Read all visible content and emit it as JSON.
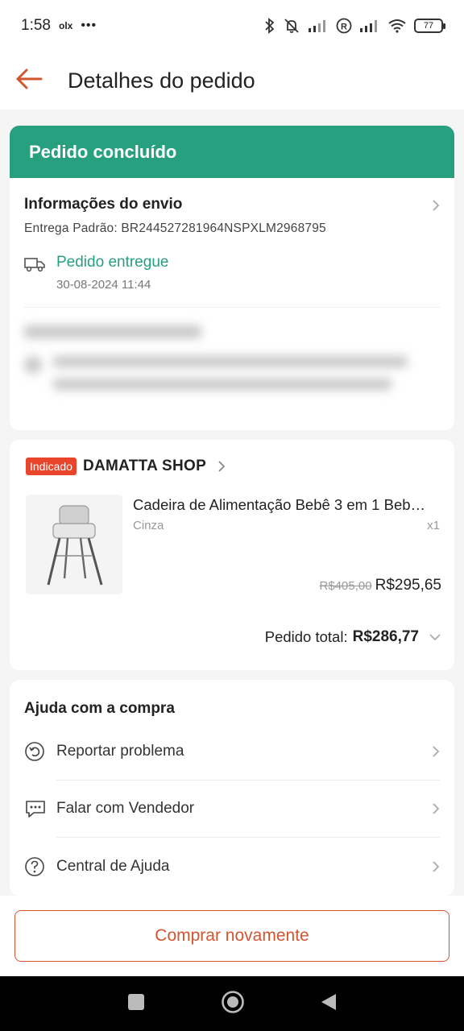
{
  "status_bar": {
    "time": "1:58",
    "olx": "olx",
    "dots": "•••",
    "battery": "77"
  },
  "header": {
    "title": "Detalhes do pedido"
  },
  "order_status": {
    "banner": "Pedido concluído",
    "shipping_title": "Informações do envio",
    "shipping_code": "Entrega Padrão: BR244527281964NSPXLM2968795",
    "delivery_status": "Pedido entregue",
    "delivery_date": "30-08-2024 11:44"
  },
  "shop": {
    "badge": "Indicado",
    "name": "DAMATTA SHOP",
    "product_name": "Cadeira de Alimentação Bebê 3 em 1 Beb…",
    "variant": "Cinza",
    "quantity": "x1",
    "old_price": "R$405,00",
    "price": "R$295,65",
    "total_label": "Pedido total:",
    "total_value": "R$286,77"
  },
  "help": {
    "title": "Ajuda com a compra",
    "items": [
      {
        "label": "Reportar problema"
      },
      {
        "label": "Falar com Vendedor"
      },
      {
        "label": "Central de Ajuda"
      }
    ]
  },
  "actions": {
    "buy_again": "Comprar novamente"
  },
  "colors": {
    "accent_green": "#26a07f",
    "accent_orange": "#d2552f",
    "badge_red": "#e8452b"
  }
}
